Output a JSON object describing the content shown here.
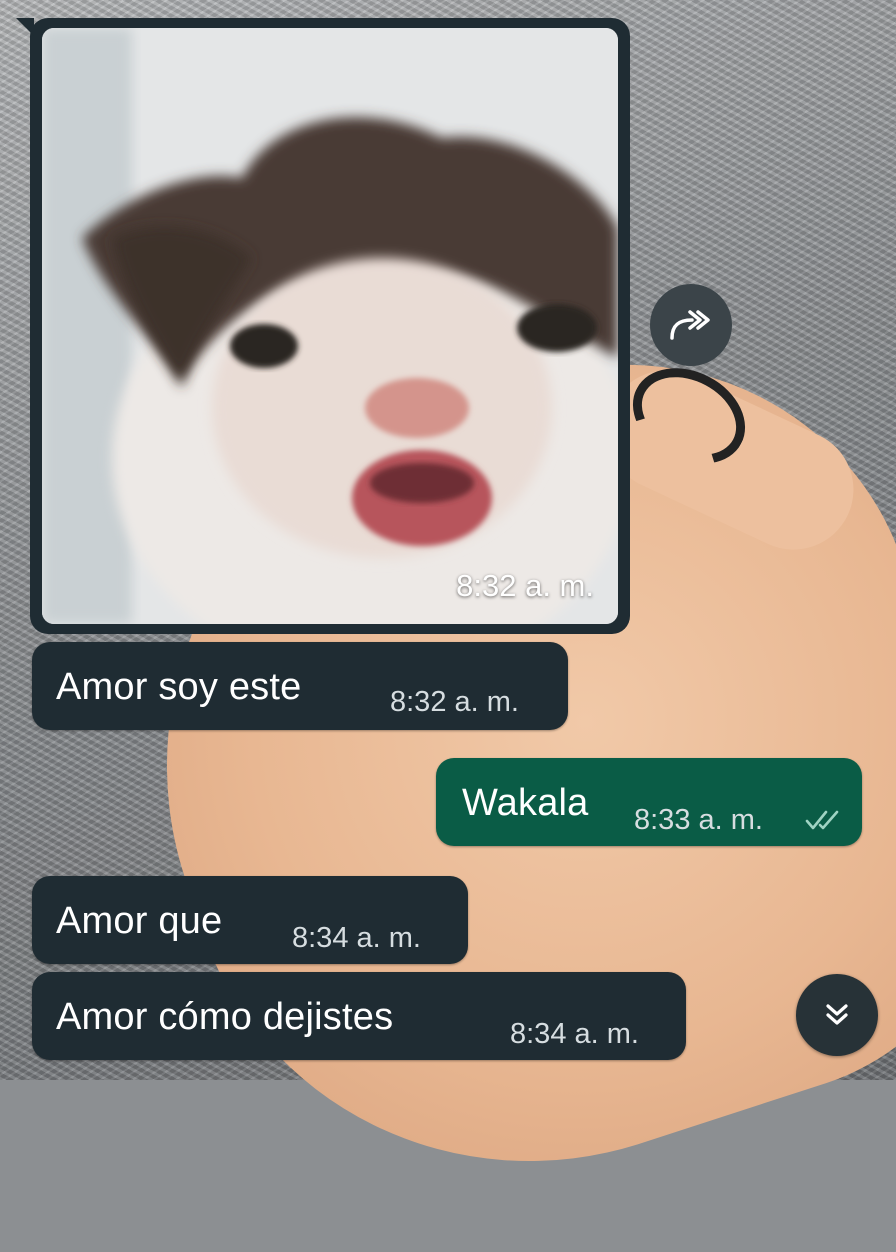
{
  "messages": [
    {
      "direction": "incoming",
      "type": "image",
      "time": "8:32 a. m."
    },
    {
      "direction": "incoming",
      "text": "Amor soy este",
      "time": "8:32 a. m."
    },
    {
      "direction": "outgoing",
      "text": "Wakala",
      "time": "8:33 a. m.",
      "status_icon": "double-check-icon"
    },
    {
      "direction": "incoming",
      "text": "Amor que",
      "time": "8:34 a. m."
    },
    {
      "direction": "incoming",
      "text": "Amor cómo dejistes",
      "time": "8:34 a. m."
    }
  ],
  "controls": {
    "forward_icon": "forward-icon",
    "scroll_icon": "double-chevron-down-icon"
  },
  "colors": {
    "incoming_bubble": "#1f2c33",
    "outgoing_bubble": "#0a5c46",
    "tick_color": "#9fd3c3"
  }
}
